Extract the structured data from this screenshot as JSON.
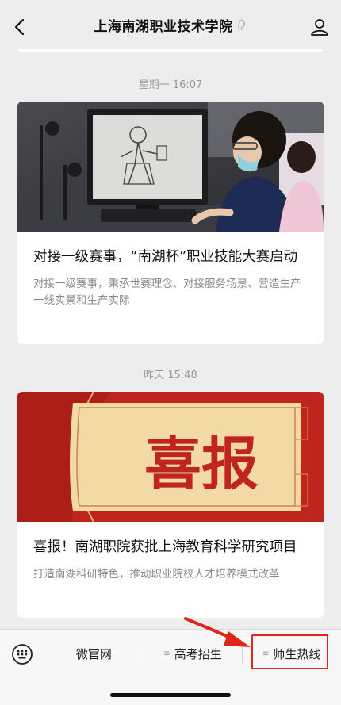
{
  "header": {
    "title": "上海南湖职业技术学院"
  },
  "feed": [
    {
      "timestamp": "星期一 16:07",
      "title": "对接一级赛事，“南湖杯”职业技能大赛启动",
      "description": "对接一级赛事，秉承世赛理念、对接服务场景、营造生产一线实景和生产实际"
    },
    {
      "timestamp": "昨天 15:48",
      "title": "喜报！南湖职院获批上海教育科学研究项目",
      "description": "打造南湖科研特色，推动职业院校人才培养模式改革",
      "banner_text": "喜报"
    }
  ],
  "menu": {
    "items": [
      {
        "label": "微官网"
      },
      {
        "label": "高考招生"
      },
      {
        "label": "师生热线"
      }
    ]
  },
  "colors": {
    "accent_red": "#e0251b",
    "banner_red": "#c0251d",
    "banner_gold": "#f3d9a4"
  }
}
